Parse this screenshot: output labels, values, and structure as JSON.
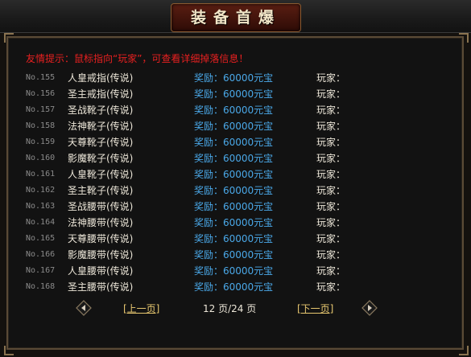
{
  "title": "装备首爆",
  "tip": "友情提示：鼠标指向“玩家”，可查看详细掉落信息！",
  "rows": [
    {
      "no": "No.155",
      "item": "人皇戒指(传说)",
      "reward": "奖励：60000元宝",
      "player": "玩家："
    },
    {
      "no": "No.156",
      "item": "圣主戒指(传说)",
      "reward": "奖励：60000元宝",
      "player": "玩家："
    },
    {
      "no": "No.157",
      "item": "圣战靴子(传说)",
      "reward": "奖励：60000元宝",
      "player": "玩家："
    },
    {
      "no": "No.158",
      "item": "法神靴子(传说)",
      "reward": "奖励：60000元宝",
      "player": "玩家："
    },
    {
      "no": "No.159",
      "item": "天尊靴子(传说)",
      "reward": "奖励：60000元宝",
      "player": "玩家："
    },
    {
      "no": "No.160",
      "item": "影魔靴子(传说)",
      "reward": "奖励：60000元宝",
      "player": "玩家："
    },
    {
      "no": "No.161",
      "item": "人皇靴子(传说)",
      "reward": "奖励：60000元宝",
      "player": "玩家："
    },
    {
      "no": "No.162",
      "item": "圣主靴子(传说)",
      "reward": "奖励：60000元宝",
      "player": "玩家："
    },
    {
      "no": "No.163",
      "item": "圣战腰带(传说)",
      "reward": "奖励：60000元宝",
      "player": "玩家："
    },
    {
      "no": "No.164",
      "item": "法神腰带(传说)",
      "reward": "奖励：60000元宝",
      "player": "玩家："
    },
    {
      "no": "No.165",
      "item": "天尊腰带(传说)",
      "reward": "奖励：60000元宝",
      "player": "玩家："
    },
    {
      "no": "No.166",
      "item": "影魔腰带(传说)",
      "reward": "奖励：60000元宝",
      "player": "玩家："
    },
    {
      "no": "No.167",
      "item": "人皇腰带(传说)",
      "reward": "奖励：60000元宝",
      "player": "玩家："
    },
    {
      "no": "No.168",
      "item": "圣主腰带(传说)",
      "reward": "奖励：60000元宝",
      "player": "玩家："
    }
  ],
  "pager": {
    "prev": "[上一页]",
    "next": "[下一页]",
    "info": "12 页/24 页"
  },
  "icons": {
    "left": "arrow-left-icon",
    "right": "arrow-right-icon"
  },
  "colors": {
    "tip": "#e82020",
    "reward": "#4aa8e8",
    "link": "#e8c870",
    "text": "#ece6d8"
  }
}
